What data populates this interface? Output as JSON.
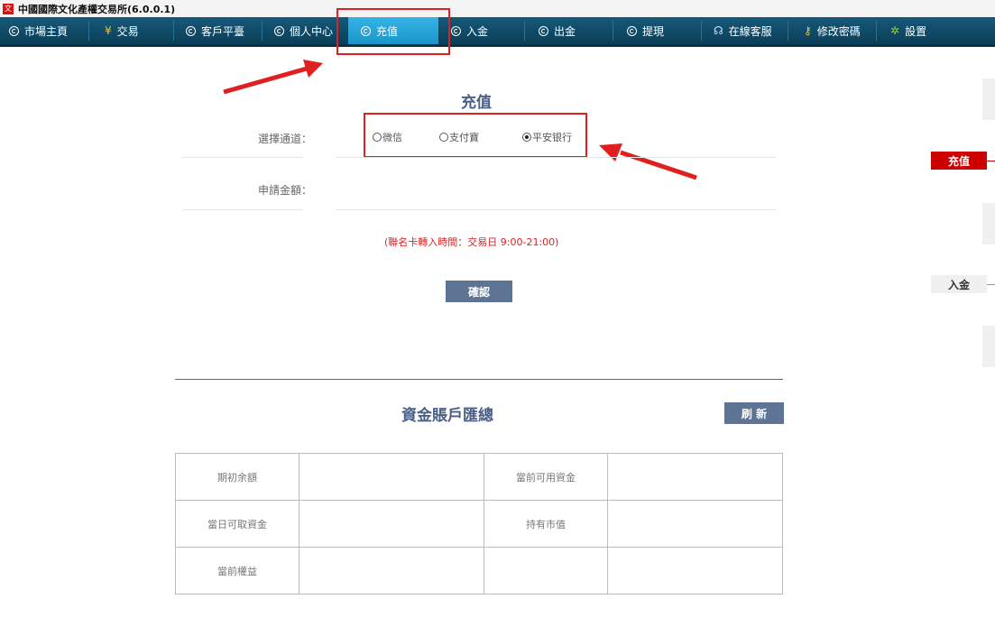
{
  "window": {
    "title": "中國國際文化產權交易所(6.0.0.1)"
  },
  "nav": {
    "items": [
      {
        "label": "市場主頁",
        "icon": "swirl-icon"
      },
      {
        "label": "交易",
        "icon": "yen-icon"
      },
      {
        "label": "客戶平臺",
        "icon": "swirl-icon"
      },
      {
        "label": "個人中心",
        "icon": "swirl-icon"
      },
      {
        "label": "充值",
        "icon": "swirl-icon",
        "active": true
      },
      {
        "label": "入金",
        "icon": "swirl-icon"
      },
      {
        "label": "出金",
        "icon": "swirl-icon"
      },
      {
        "label": "提現",
        "icon": "swirl-icon"
      },
      {
        "label": "在線客服",
        "icon": "headset-icon"
      },
      {
        "label": "修改密碼",
        "icon": "key-icon"
      },
      {
        "label": "設置",
        "icon": "gear-icon"
      }
    ],
    "yen_glyph": "¥"
  },
  "recharge": {
    "title": "充值",
    "channel_label": "選擇通道：",
    "channels": [
      {
        "label": "微信",
        "checked": false
      },
      {
        "label": "支付寶",
        "checked": false
      },
      {
        "label": "平安银行",
        "checked": true
      }
    ],
    "amount_label": "申請金額：",
    "amount_value": "",
    "note": "(聯名卡轉入時間：交易日 9:00-21:00)",
    "confirm_label": "確認"
  },
  "summary": {
    "title": "資金賬戶匯總",
    "refresh_label": "刷 新",
    "rows": [
      [
        "期初余額",
        "",
        "當前可用資金",
        ""
      ],
      [
        "當日可取資金",
        "",
        "持有市值",
        ""
      ],
      [
        "當前權益",
        "",
        "",
        ""
      ]
    ]
  },
  "sidebar": {
    "tabs": [
      {
        "label": "充值",
        "active": true
      },
      {
        "label": "入金",
        "active": false
      }
    ]
  },
  "colors": {
    "nav_bg": "#0b3e57",
    "nav_active": "#1a95c9",
    "accent_red": "#e02020",
    "title_blue": "#4a5f86",
    "button_bg": "#5e7495"
  }
}
